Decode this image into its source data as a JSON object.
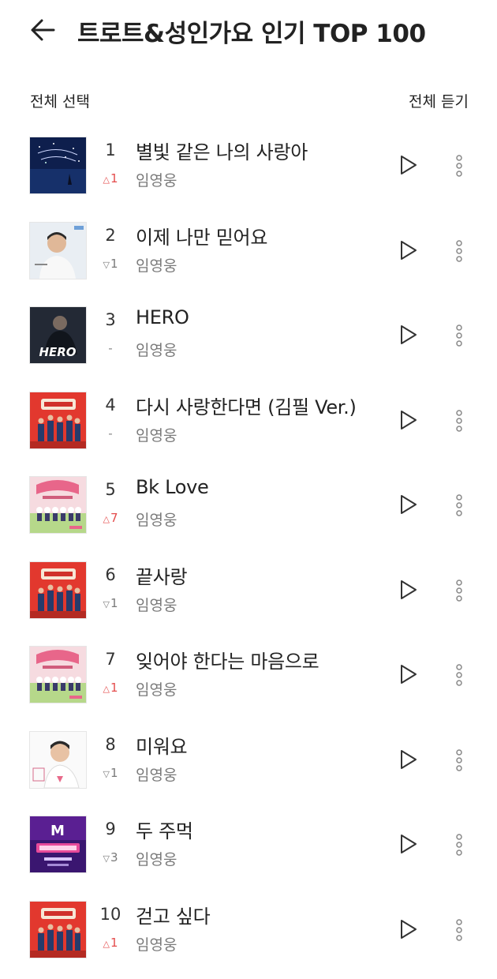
{
  "header": {
    "title": "트로트&성인가요 인기 TOP 100"
  },
  "toolbar": {
    "select_all": "전체 선택",
    "listen_all": "전체 듣기"
  },
  "colors": {
    "rank_up": "#e44c4c",
    "rank_down": "#7a7a7a",
    "text": "#222222",
    "subtext": "#7a7a7a"
  },
  "icons": {
    "back": "arrow-left-icon",
    "play": "play-outline-icon",
    "more": "vertical-dots-icon"
  },
  "songs": [
    {
      "rank": "1",
      "change": "1",
      "dir": "up",
      "title": "별빛 같은 나의 사랑아",
      "artist": "임영웅",
      "art": "starry-night"
    },
    {
      "rank": "2",
      "change": "1",
      "dir": "down",
      "title": "이제 나만 믿어요",
      "artist": "임영웅",
      "art": "portrait-light"
    },
    {
      "rank": "3",
      "change": "-",
      "dir": "same",
      "title": "HERO",
      "artist": "임영웅",
      "art": "hero-dark"
    },
    {
      "rank": "4",
      "change": "-",
      "dir": "same",
      "title": "다시 사랑한다면 (김필 Ver.)",
      "artist": "임영웅",
      "art": "red-group"
    },
    {
      "rank": "5",
      "change": "7",
      "dir": "up",
      "title": "Bk Love",
      "artist": "임영웅",
      "art": "pink-group"
    },
    {
      "rank": "6",
      "change": "1",
      "dir": "down",
      "title": "끝사랑",
      "artist": "임영웅",
      "art": "red-group"
    },
    {
      "rank": "7",
      "change": "1",
      "dir": "up",
      "title": "잊어야 한다는 마음으로",
      "artist": "임영웅",
      "art": "pink-group"
    },
    {
      "rank": "8",
      "change": "1",
      "dir": "down",
      "title": "미워요",
      "artist": "임영웅",
      "art": "portrait-white"
    },
    {
      "rank": "9",
      "change": "3",
      "dir": "down",
      "title": "두 주먹",
      "artist": "임영웅",
      "art": "mister-trot"
    },
    {
      "rank": "10",
      "change": "1",
      "dir": "up",
      "title": "걷고 싶다",
      "artist": "임영웅",
      "art": "red-group"
    }
  ]
}
